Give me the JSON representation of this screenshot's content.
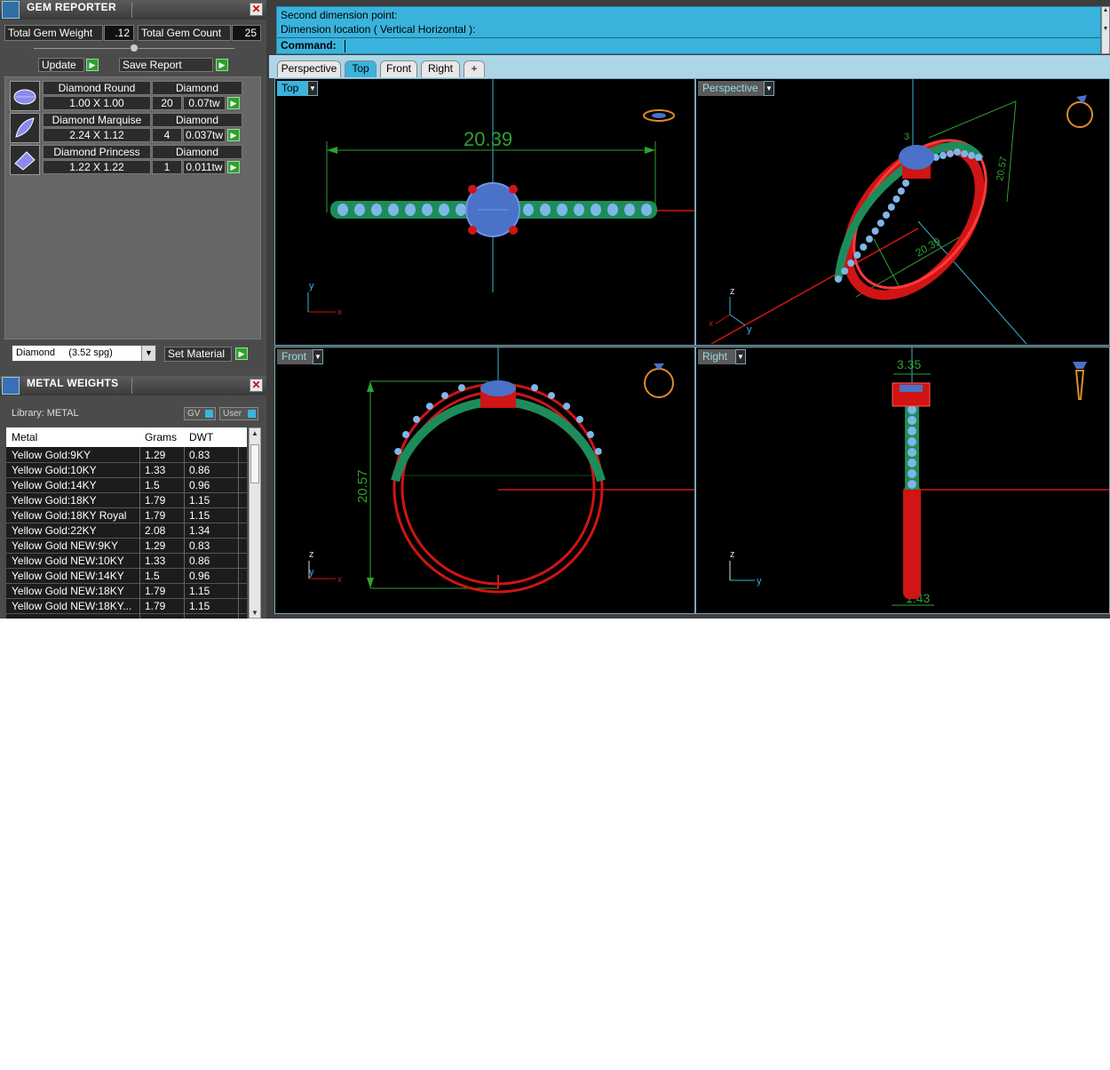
{
  "gem_reporter": {
    "title": "GEM REPORTER",
    "total_weight_label": "Total Gem Weight",
    "total_weight_value": ".12",
    "total_count_label": "Total Gem Count",
    "total_count_value": "25",
    "update_label": "Update",
    "save_report_label": "Save Report",
    "gems": [
      {
        "name": "Diamond Round",
        "type": "Diamond",
        "size": "1.00 X 1.00",
        "count": "20",
        "weight": "0.07tw",
        "icon": "round-gem-icon"
      },
      {
        "name": "Diamond Marquise",
        "type": "Diamond",
        "size": "2.24 X 1.12",
        "count": "4",
        "weight": "0.037tw",
        "icon": "marquise-gem-icon"
      },
      {
        "name": "Diamond Princess",
        "type": "Diamond",
        "size": "1.22 X 1.22",
        "count": "1",
        "weight": "0.011tw",
        "icon": "princess-gem-icon"
      }
    ],
    "material_select": "Diamond     (3.52 spg)",
    "set_material_label": "Set Material"
  },
  "metal_weights": {
    "title": "METAL WEIGHTS",
    "library_label": "Library: METAL",
    "toggle_gv": "GV",
    "toggle_user": "User",
    "columns": [
      "Metal",
      "Grams",
      "DWT"
    ],
    "rows": [
      [
        "Yellow Gold:9KY",
        "1.29",
        "0.83"
      ],
      [
        "Yellow Gold:10KY",
        "1.33",
        "0.86"
      ],
      [
        "Yellow Gold:14KY",
        "1.5",
        "0.96"
      ],
      [
        "Yellow Gold:18KY",
        "1.79",
        "1.15"
      ],
      [
        "Yellow Gold:18KY Royal",
        "1.79",
        "1.15"
      ],
      [
        "Yellow Gold:22KY",
        "2.08",
        "1.34"
      ],
      [
        "Yellow Gold NEW:9KY",
        "1.29",
        "0.83"
      ],
      [
        "Yellow Gold NEW:10KY",
        "1.33",
        "0.86"
      ],
      [
        "Yellow Gold NEW:14KY",
        "1.5",
        "0.96"
      ],
      [
        "Yellow Gold NEW:18KY",
        "1.79",
        "1.15"
      ],
      [
        "Yellow Gold NEW:18KY...",
        "1.79",
        "1.15"
      ]
    ]
  },
  "command": {
    "line1": "Second dimension point:",
    "line2": "Dimension location ( Vertical  Horizontal ):",
    "prompt": "Command:"
  },
  "tabs": [
    "Perspective",
    "Top",
    "Front",
    "Right",
    "+"
  ],
  "active_tab": "Top",
  "viewports": {
    "top": {
      "label": "Top",
      "dimension": "20.39",
      "axis_x": "x",
      "axis_y": "y"
    },
    "perspective": {
      "label": "Perspective",
      "dim_a": "3",
      "dim_b": "20.39",
      "dim_c": "20.57",
      "axis_x": "x",
      "axis_y": "y",
      "axis_z": "z"
    },
    "front": {
      "label": "Front",
      "dimension": "20.57",
      "axis_x": "x",
      "axis_y": "y",
      "axis_z": "z"
    },
    "right": {
      "label": "Right",
      "dim_top": "3.35",
      "dim_bottom": "1.43",
      "axis_y": "y",
      "axis_z": "z"
    }
  },
  "colors": {
    "accent": "#3ab3dc",
    "metal": "#d11414",
    "gem_band": "#1e8c5a",
    "center_stone": "#4a72c8",
    "dimension": "#2fa02f"
  }
}
